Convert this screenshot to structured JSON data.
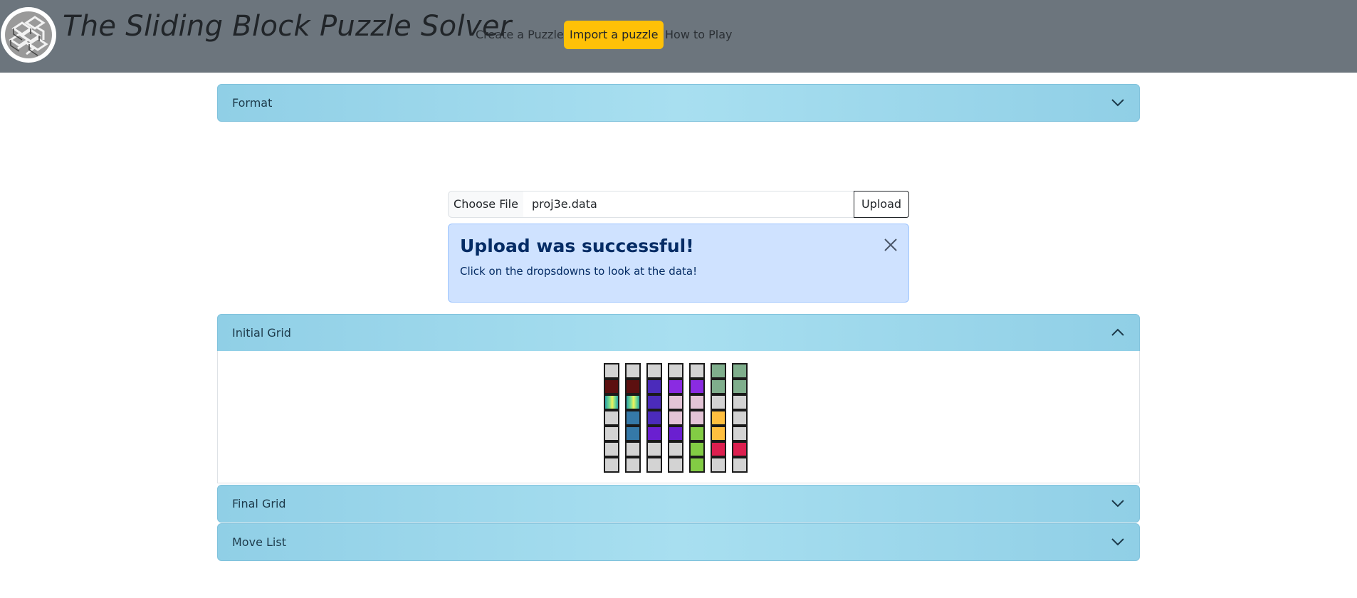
{
  "navbar": {
    "brand": "The Sliding Block Puzzle Solver",
    "links": [
      {
        "label": "Create a Puzzle",
        "active": false
      },
      {
        "label": "Import a puzzle",
        "active": true
      },
      {
        "label": "How to Play",
        "active": false
      }
    ],
    "active_color": "#ffc107"
  },
  "format_section": {
    "label": "Format",
    "expanded": false
  },
  "file_upload": {
    "choose_label": "Choose File",
    "file_name": "proj3e.data",
    "upload_label": "Upload"
  },
  "alert": {
    "title": "Upload was successful!",
    "message": "Click on the dropsdowns to look at the data!"
  },
  "initial_grid": {
    "label": "Initial Grid",
    "expanded": true,
    "rows": [
      [
        "#d3d3d3",
        "#d3d3d3",
        "#d3d3d3",
        "#d3d3d3",
        "#d3d3d3",
        "#7fae8c",
        "#7fae8c"
      ],
      [
        "#5c1010",
        "#5c1010",
        "#4b2bbb",
        "#8a2be2",
        "#8a2be2",
        "#7fae8c",
        "#7fae8c"
      ],
      [
        "gradient",
        "gradient",
        "#4b2bbb",
        "#e3c4d6",
        "#e3c4d6",
        "#d3d3d3",
        "#d3d3d3"
      ],
      [
        "#d3d3d3",
        "#3579a8",
        "#4b2bbb",
        "#e3c4d6",
        "#e3c4d6",
        "#ffbf3f",
        "#d3d3d3"
      ],
      [
        "#d3d3d3",
        "#3579a8",
        "#6a1fd0",
        "#6a1fd0",
        "#82cc44",
        "#ffbf3f",
        "#d3d3d3"
      ],
      [
        "#d3d3d3",
        "#d3d3d3",
        "#d3d3d3",
        "#d3d3d3",
        "#82cc44",
        "#dc1f4f",
        "#dc1f4f"
      ],
      [
        "#d3d3d3",
        "#d3d3d3",
        "#d3d3d3",
        "#d3d3d3",
        "#82cc44",
        "#d3d3d3",
        "#d3d3d3"
      ]
    ]
  },
  "final_grid": {
    "label": "Final Grid",
    "expanded": false
  },
  "move_list": {
    "label": "Move List",
    "expanded": false
  }
}
